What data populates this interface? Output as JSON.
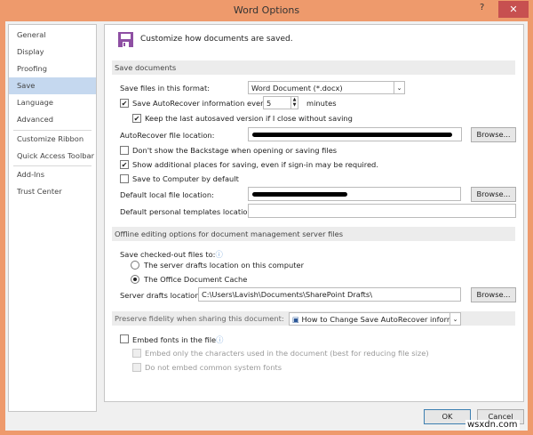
{
  "window": {
    "title": "Word Options",
    "help": "?",
    "close": "✕"
  },
  "sidebar": {
    "items": [
      {
        "label": "General"
      },
      {
        "label": "Display"
      },
      {
        "label": "Proofing"
      },
      {
        "label": "Save"
      },
      {
        "label": "Language"
      },
      {
        "label": "Advanced"
      },
      {
        "label": "Customize Ribbon"
      },
      {
        "label": "Quick Access Toolbar"
      },
      {
        "label": "Add-Ins"
      },
      {
        "label": "Trust Center"
      }
    ],
    "selected": "Save"
  },
  "header": {
    "text": "Customize how documents are saved."
  },
  "save_documents": {
    "title": "Save documents",
    "format_label": "Save files in this format:",
    "format_value": "Word Document (*.docx)",
    "autorecover_label": "Save AutoRecover information every",
    "autorecover_checked": true,
    "minutes_value": "5",
    "minutes_label": "minutes",
    "keep_label": "Keep the last autosaved version if I close without saving",
    "keep_checked": true,
    "ar_location_label": "AutoRecover file location:",
    "browse": "Browse...",
    "backstage_label": "Don't show the Backstage when opening or saving files",
    "backstage_checked": false,
    "additional_label": "Show additional places for saving, even if sign-in may be required.",
    "additional_checked": true,
    "computer_label": "Save to Computer by default",
    "computer_checked": false,
    "local_label": "Default local file location:",
    "templates_label": "Default personal templates location:",
    "templates_value": ""
  },
  "offline": {
    "title": "Offline editing options for document management server files",
    "checked_out_label": "Save checked-out files to:",
    "radio1": "The server drafts location on this computer",
    "radio2": "The Office Document Cache",
    "selected": "The Office Document Cache",
    "drafts_label": "Server drafts location:",
    "drafts_value": "C:\\Users\\Lavish\\Documents\\SharePoint Drafts\\",
    "browse": "Browse..."
  },
  "fidelity": {
    "title": "Preserve fidelity when sharing this document:",
    "doc_value": "How to Change Save AutoRecover inform...",
    "embed_label": "Embed fonts in the file",
    "embed_checked": false,
    "only_chars_label": "Embed only the characters used in the document (best for reducing file size)",
    "no_common_label": "Do not embed common system fonts"
  },
  "footer": {
    "ok": "OK",
    "cancel": "Cancel"
  },
  "watermark": "wsxdn.com",
  "colors": {
    "frame": "#ee9a6c",
    "selected": "#c5d8ef",
    "close": "#c75050",
    "icon": "#8e4fa3"
  }
}
